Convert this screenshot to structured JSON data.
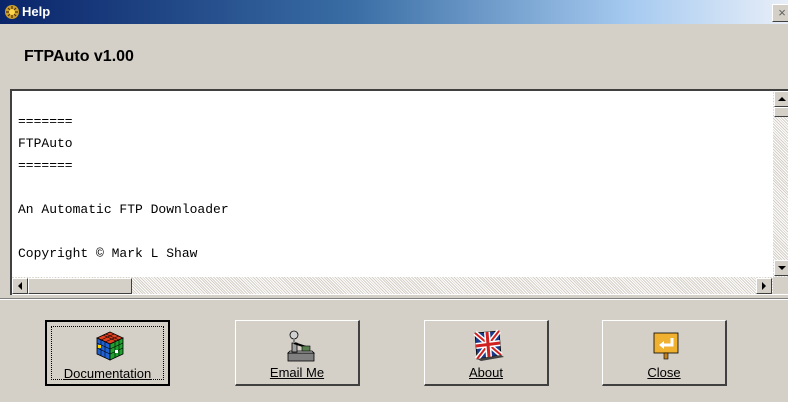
{
  "window": {
    "title": "Help"
  },
  "app_title": "FTPAuto v1.00",
  "close_glyph": "×",
  "text_lines": [
    "=======",
    "FTPAuto",
    "=======",
    "",
    "An Automatic FTP Downloader",
    "",
    "Copyright © Mark L Shaw"
  ],
  "buttons": [
    {
      "label": "Documentation",
      "icon": "rubiks-cube-icon"
    },
    {
      "label": "Email Me",
      "icon": "telegraph-key-icon"
    },
    {
      "label": "About",
      "icon": "union-jack-flag-icon"
    },
    {
      "label": "Close",
      "icon": "exit-arrow-icon"
    }
  ],
  "colors": {
    "title_start": "#0a246a",
    "title_end": "#e8eef8",
    "face": "#d4d0c8"
  }
}
